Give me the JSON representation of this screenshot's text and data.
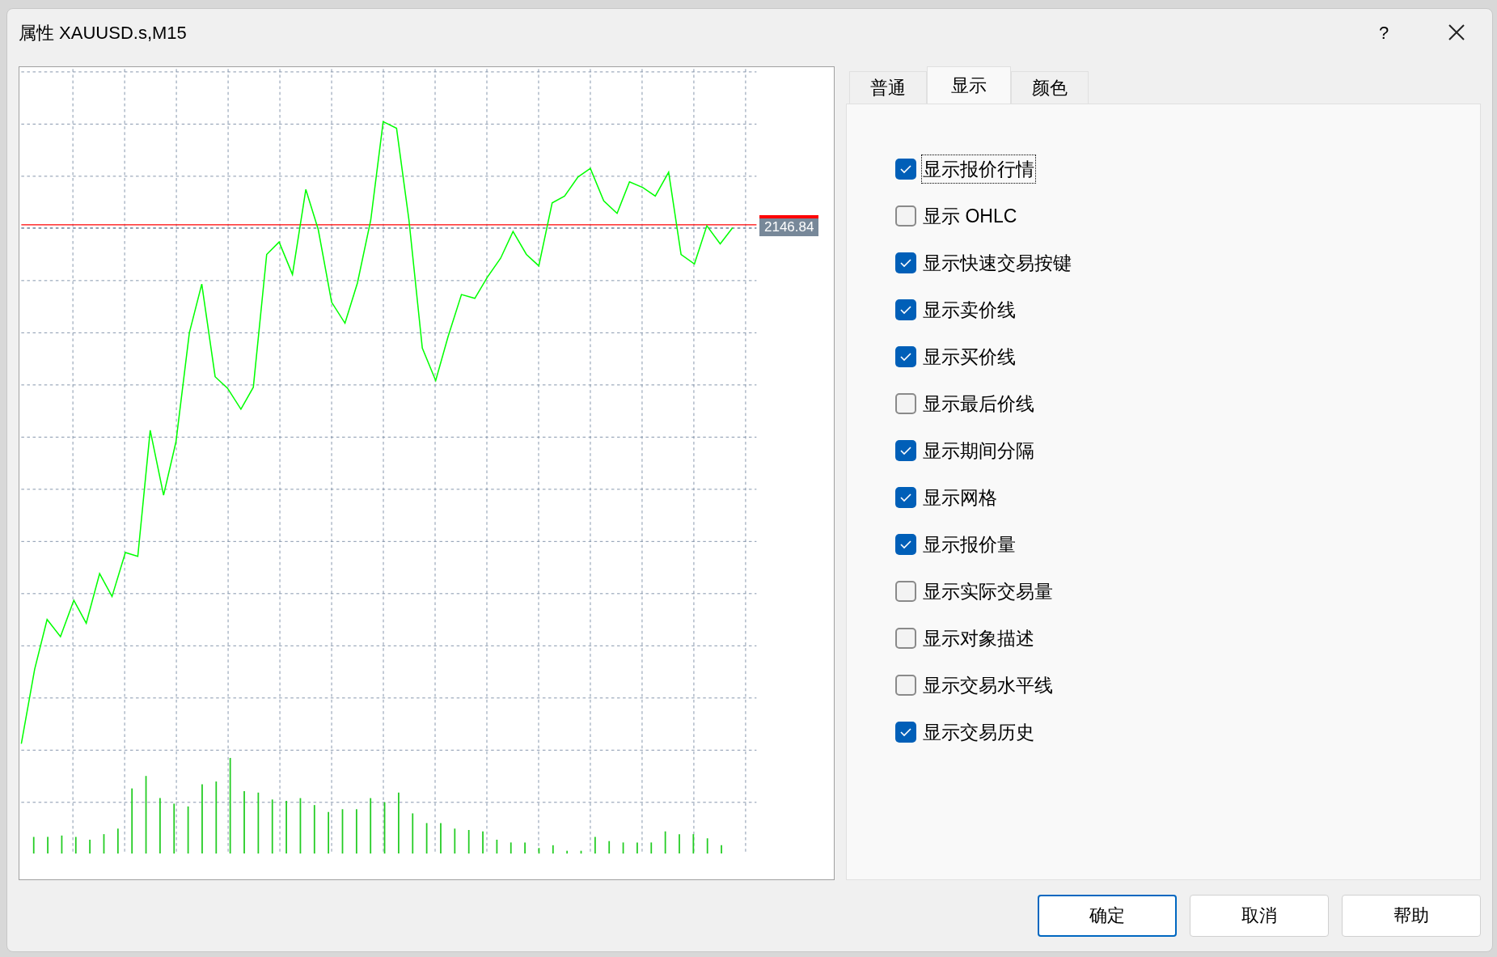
{
  "window": {
    "title": "属性 XAUUSD.s,M15",
    "help": "?"
  },
  "chart_preview": {
    "price_label": "2146.84"
  },
  "tabs": [
    {
      "label": "普通",
      "selected": false
    },
    {
      "label": "显示",
      "selected": true
    },
    {
      "label": "颜色",
      "selected": false
    }
  ],
  "options": [
    {
      "label": "显示报价行情",
      "checked": true,
      "focused": true
    },
    {
      "label": "显示 OHLC",
      "checked": false,
      "focused": false
    },
    {
      "label": "显示快速交易按键",
      "checked": true,
      "focused": false
    },
    {
      "label": "显示卖价线",
      "checked": true,
      "focused": false
    },
    {
      "label": "显示买价线",
      "checked": true,
      "focused": false
    },
    {
      "label": "显示最后价线",
      "checked": false,
      "focused": false
    },
    {
      "label": "显示期间分隔",
      "checked": true,
      "focused": false
    },
    {
      "label": "显示网格",
      "checked": true,
      "focused": false
    },
    {
      "label": "显示报价量",
      "checked": true,
      "focused": false
    },
    {
      "label": "显示实际交易量",
      "checked": false,
      "focused": false
    },
    {
      "label": "显示对象描述",
      "checked": false,
      "focused": false
    },
    {
      "label": "显示交易水平线",
      "checked": false,
      "focused": false
    },
    {
      "label": "显示交易历史",
      "checked": true,
      "focused": false
    }
  ],
  "buttons": [
    {
      "label": "确定",
      "default": true
    },
    {
      "label": "取消",
      "default": false
    },
    {
      "label": "帮助",
      "default": false
    }
  ]
}
